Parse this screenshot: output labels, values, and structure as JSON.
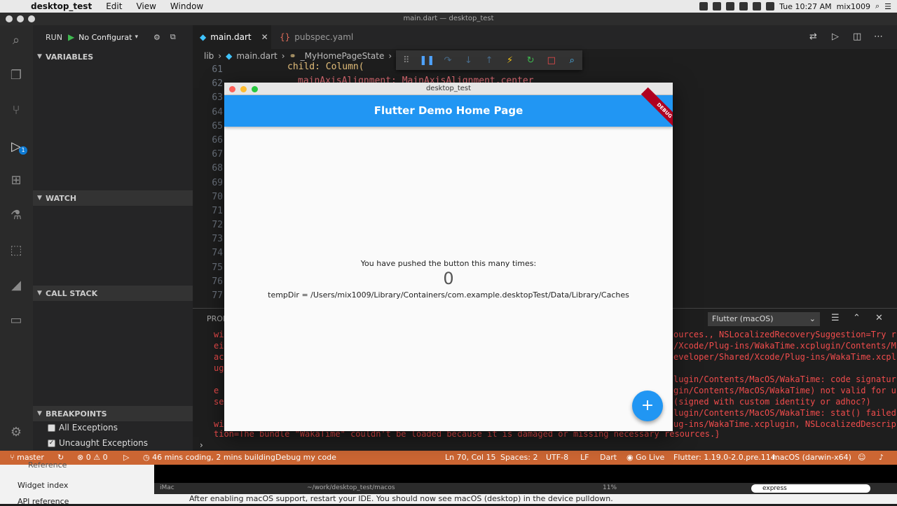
{
  "menubar": {
    "app": "desktop_test",
    "items": [
      "Edit",
      "View",
      "Window"
    ],
    "clock": "Tue 10:27 AM",
    "user": "mix1009"
  },
  "window_title": "main.dart — desktop_test",
  "run": {
    "label": "RUN",
    "config": "No Configurat"
  },
  "sidebar": {
    "variables": "VARIABLES",
    "watch": "WATCH",
    "call_stack": "CALL STACK",
    "breakpoints": "BREAKPOINTS",
    "bp_items": [
      {
        "label": "All Exceptions",
        "checked": false
      },
      {
        "label": "Uncaught Exceptions",
        "checked": true
      }
    ],
    "badge": "1"
  },
  "tabs": [
    {
      "label": "main.dart",
      "active": true
    },
    {
      "label": "pubspec.yaml",
      "active": false
    }
  ],
  "breadcrumb": [
    "lib",
    "main.dart",
    "_MyHomePageState"
  ],
  "gutter": [
    "61",
    "62",
    "63",
    "64",
    "65",
    "66",
    "67",
    "68",
    "69",
    "70",
    "71",
    "72",
    "73",
    "74",
    "75",
    "76",
    "77"
  ],
  "code": {
    "line61": "child: Column(",
    "line62": "mainAxisAlignment: MainAxisAlignment.center"
  },
  "panel": {
    "tab_label": "PROB",
    "selector": "Flutter (macOS)",
    "left_frag": [
      "wi",
      "ei",
      "ac",
      "ug",
      "e",
      "se",
      "wi"
    ],
    "errors": [
      "ources., NSLocalizedRecoverySuggestion=Try r",
      "/Xcode/Plug-ins/WakaTime.xcplugin/Contents/M",
      "eveloper/Shared/Xcode/Plug-ins/WakaTime.xcpl",
      "lugin/Contents/MacOS/WakaTime: code signatur",
      "gin/Contents/MacOS/WakaTime) not valid for u",
      " (signed with custom identity or adhoc?)",
      "lugin/Contents/MacOS/WakaTime: stat() failed",
      "ug-ins/WakaTime.xcplugin, NSLocalizedDescrip"
    ],
    "bottom_line": "tion=The bundle \"WakaTime\" couldn't be loaded because it is damaged or missing necessary resources.}"
  },
  "statusbar": {
    "branch": "master",
    "errors": "0",
    "warnings": "0",
    "waka": "46 mins coding, 2 mins building",
    "debug": "Debug my code",
    "position": "Ln 70, Col 15",
    "spaces": "Spaces: 2",
    "encoding": "UTF-8",
    "eol": "LF",
    "language": "Dart",
    "golive": "Go Live",
    "flutter": "Flutter: 1.19.0-2.0.pre.114",
    "device": "macOS (darwin-x64)"
  },
  "below": {
    "ref": "Reference",
    "widget_index": "Widget index",
    "api_ref": "API reference",
    "term_left": "iMac",
    "term_path": "~/work/desktop_test/macos",
    "zoom": "11%",
    "search": "express",
    "hint": "After enabling macOS support, restart your IDE. You should now see macOS (desktop) in the device pulldown."
  },
  "flutter_app": {
    "window_title": "desktop_test",
    "appbar_title": "Flutter Demo Home Page",
    "ribbon": "DEBUG",
    "message": "You have pushed the button this many times:",
    "counter": "0",
    "tempdir": "tempDir = /Users/mix1009/Library/Containers/com.example.desktopTest/Data/Library/Caches",
    "fab": "+"
  },
  "colors": {
    "status_bar": "#cc6633",
    "appbar": "#2196f3",
    "error_text": "#f14c4c"
  }
}
